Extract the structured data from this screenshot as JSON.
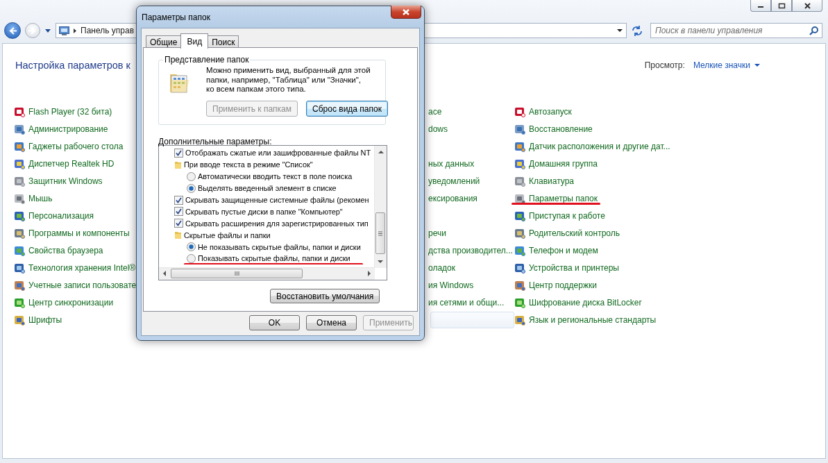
{
  "explorer": {
    "address": "Панель управ",
    "search": {
      "placeholder": "Поиск в панели управления"
    },
    "heading": "Настройка параметров к",
    "view_label": "Просмотр:",
    "view_value": "Мелкие значки",
    "columns": [
      {
        "items": [
          {
            "kind": "link",
            "label": "Flash Player (32 бита)",
            "underlined": false
          },
          {
            "kind": "link",
            "label": "Администрирование",
            "underlined": false
          },
          {
            "kind": "link",
            "label": "Гаджеты рабочего стола",
            "underlined": false
          },
          {
            "kind": "link",
            "label": "Диспетчер Realtek HD",
            "underlined": false
          },
          {
            "kind": "link",
            "label": "Защитник Windows",
            "underlined": false
          },
          {
            "kind": "link",
            "label": "Мышь",
            "underlined": false
          },
          {
            "kind": "link",
            "label": "Персонализация",
            "underlined": false
          },
          {
            "kind": "link",
            "label": "Программы и компоненты",
            "underlined": false
          },
          {
            "kind": "link",
            "label": "Свойства браузера",
            "underlined": false
          },
          {
            "kind": "link",
            "label": "Технология хранения Intel®",
            "underlined": false
          },
          {
            "kind": "link",
            "label": "Учетные записи пользовате",
            "underlined": false
          },
          {
            "kind": "link",
            "label": "Центр синхронизации",
            "underlined": false
          },
          {
            "kind": "link",
            "label": "Шрифты",
            "underlined": false
          }
        ]
      },
      {
        "items": [
          {
            "kind": "fragment",
            "label": "ace"
          },
          {
            "kind": "fragment",
            "label": "dows"
          },
          {
            "kind": "blank",
            "highlighted": false
          },
          {
            "kind": "fragment",
            "label": "ных данных"
          },
          {
            "kind": "fragment",
            "label": "уведомлений"
          },
          {
            "kind": "fragment",
            "label": "ексирования"
          },
          {
            "kind": "blank",
            "highlighted": false
          },
          {
            "kind": "fragment",
            "label": "речи"
          },
          {
            "kind": "fragment",
            "label": "дства производител..."
          },
          {
            "kind": "fragment",
            "label": "оладок"
          },
          {
            "kind": "fragment",
            "label": "ия Windows"
          },
          {
            "kind": "fragment",
            "label": "ия сетями и общи..."
          },
          {
            "kind": "blank",
            "highlighted": true
          }
        ]
      },
      {
        "items": [
          {
            "kind": "link",
            "label": "Автозапуск",
            "underlined": false
          },
          {
            "kind": "link",
            "label": "Восстановление",
            "underlined": false
          },
          {
            "kind": "link",
            "label": "Датчик расположения и другие дат...",
            "underlined": false
          },
          {
            "kind": "link",
            "label": "Домашняя группа",
            "underlined": false
          },
          {
            "kind": "link",
            "label": "Клавиатура",
            "underlined": false
          },
          {
            "kind": "link",
            "label": "Параметры папок",
            "underlined": true
          },
          {
            "kind": "link",
            "label": "Приступая к работе",
            "underlined": false
          },
          {
            "kind": "link",
            "label": "Родительский контроль",
            "underlined": false
          },
          {
            "kind": "link",
            "label": "Телефон и модем",
            "underlined": false
          },
          {
            "kind": "link",
            "label": "Устройства и принтеры",
            "underlined": false
          },
          {
            "kind": "link",
            "label": "Центр поддержки",
            "underlined": false
          },
          {
            "kind": "link",
            "label": "Шифрование диска BitLocker",
            "underlined": false
          },
          {
            "kind": "link",
            "label": "Язык и региональные стандарты",
            "underlined": false
          }
        ]
      }
    ]
  },
  "dialog": {
    "title": "Параметры папок",
    "tabs": [
      {
        "label": "Общие",
        "selected": false
      },
      {
        "label": "Вид",
        "selected": true
      },
      {
        "label": "Поиск",
        "selected": false
      }
    ],
    "group": {
      "title": "Представление папок",
      "text": "Можно применить вид, выбранный для этой\nпапки, например, \"Таблица\" или \"Значки\",\nко всем папкам этого типа.",
      "buttons": [
        {
          "label": "Применить к папкам",
          "disabled": true,
          "focused": false
        },
        {
          "label": "Сброс вида папок",
          "disabled": false,
          "focused": true
        }
      ]
    },
    "advanced_label": "Дополнительные параметры:",
    "settings": [
      {
        "kind": "checkbox",
        "label": "Отображать сжатые или зашифрованные файлы NT",
        "checked": true
      },
      {
        "kind": "folder",
        "label": "При вводе текста в режиме \"Список\"",
        "children": [
          {
            "kind": "radio",
            "label": "Автоматически вводить текст в поле поиска",
            "selected": false,
            "underlined": false
          },
          {
            "kind": "radio",
            "label": "Выделять введенный элемент в списке",
            "selected": true,
            "underlined": false
          }
        ]
      },
      {
        "kind": "checkbox",
        "label": "Скрывать защищенные системные файлы (рекомен",
        "checked": true
      },
      {
        "kind": "checkbox",
        "label": "Скрывать пустые диски в папке \"Компьютер\"",
        "checked": true
      },
      {
        "kind": "checkbox",
        "label": "Скрывать расширения для зарегистрированных тип",
        "checked": true
      },
      {
        "kind": "folder",
        "label": "Скрытые файлы и папки",
        "children": [
          {
            "kind": "radio",
            "label": "Не показывать скрытые файлы, папки и диски",
            "selected": true,
            "underlined": false
          },
          {
            "kind": "radio",
            "label": "Показывать скрытые файлы, папки и диски",
            "selected": false,
            "underlined": true
          }
        ]
      }
    ],
    "restore_button": "Восстановить умолчания",
    "buttons": [
      {
        "label": "OK",
        "disabled": false
      },
      {
        "label": "Отмена",
        "disabled": false
      },
      {
        "label": "Применить",
        "disabled": true
      }
    ]
  }
}
